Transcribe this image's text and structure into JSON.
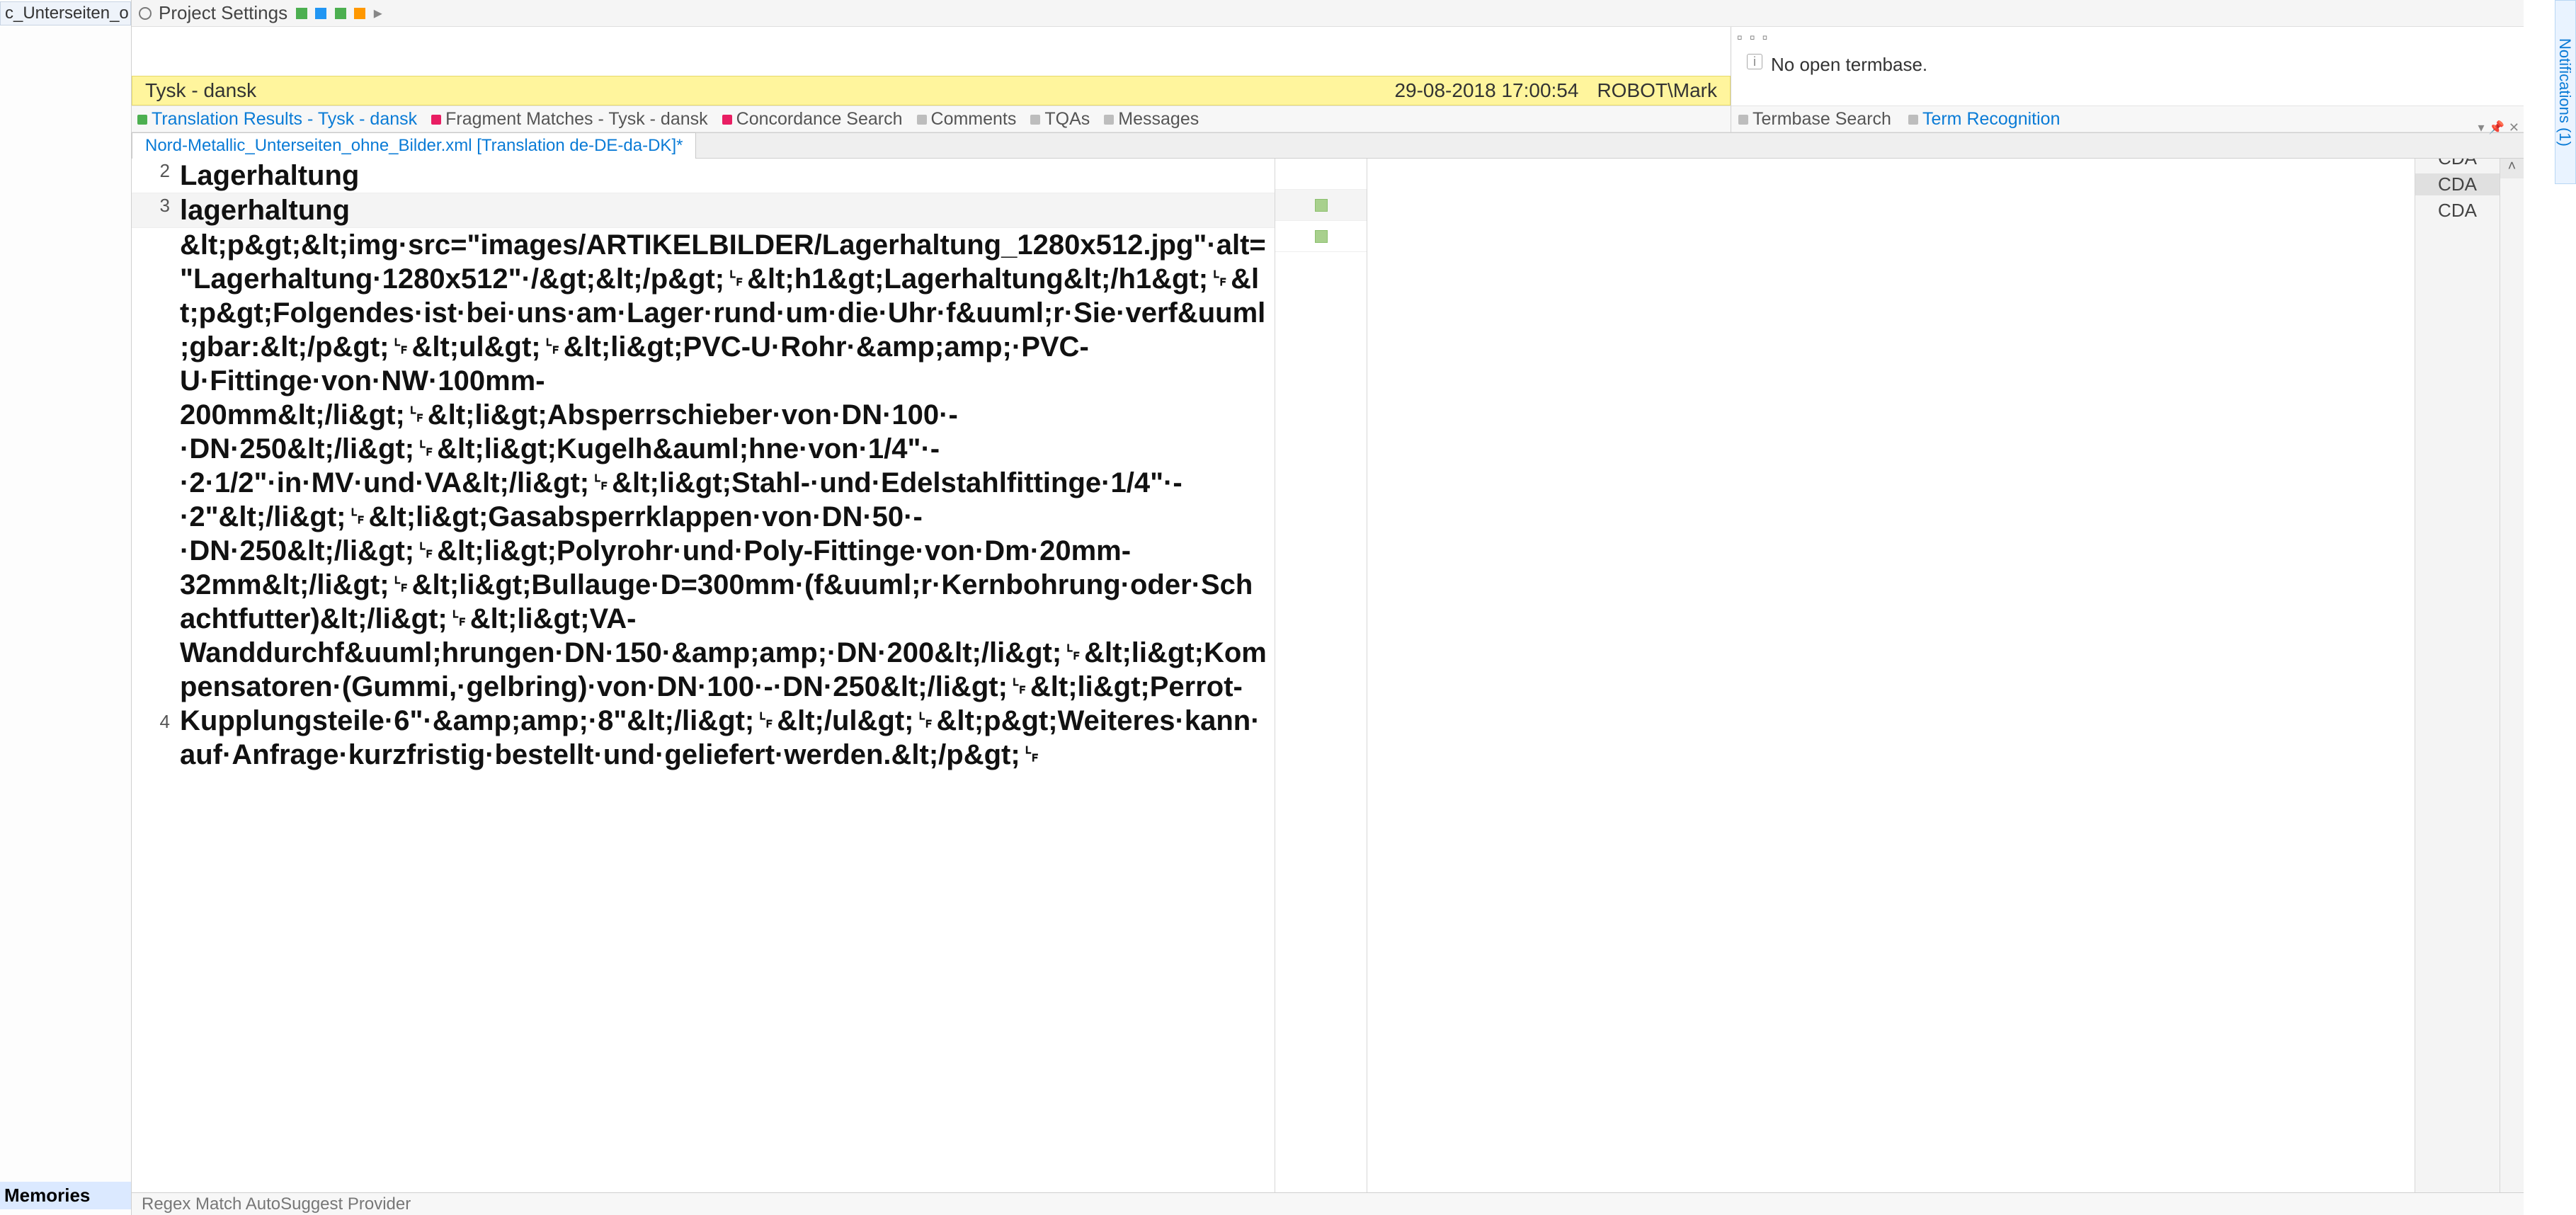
{
  "leftStrip": {
    "tabLabel": "c_Unterseiten_o",
    "bottom": "Memories"
  },
  "projectRow": {
    "title": "Project Settings"
  },
  "yellowBar": {
    "left": "Tysk - dansk",
    "date": "29-08-2018 17:00:54",
    "user": "ROBOT\\Mark"
  },
  "tmTabs": {
    "t1": "Translation Results - Tysk - dansk",
    "t2": "Fragment Matches - Tysk - dansk",
    "t3": "Concordance Search",
    "t4": "Comments",
    "t5": "TQAs",
    "t6": "Messages"
  },
  "termbase": {
    "msg": "No open termbase.",
    "tab1": "Termbase Search",
    "tab2": "Term Recognition"
  },
  "docTab": "Nord-Metallic_Unterseiten_ohne_Bilder.xml [Translation de-DE-da-DK]*",
  "rightCol": {
    "cda1": "CDA",
    "cda2": "CDA",
    "cda3": "CDA"
  },
  "segments": {
    "n2": "2",
    "s2": "Lagerhaltung",
    "n3": "3",
    "s3": "lagerhaltung",
    "n4": "4",
    "s4": "&lt;p&gt;&lt;img·src=\"images/ARTIKELBILDER/Lagerhaltung_1280x512.jpg\"·alt=\"Lagerhaltung·1280x512\"·/&gt;&lt;/p&gt;␊&lt;h1&gt;Lagerhaltung&lt;/h1&gt;␊&lt;p&gt;Folgendes·ist·bei·uns·am·Lager·rund·um·die·Uhr·f&uuml;r·Sie·verf&uuml;gbar:&lt;/p&gt;␊&lt;ul&gt;␊&lt;li&gt;PVC-U·Rohr·&amp;amp;·PVC-U·Fittinge·von·NW·100mm-200mm&lt;/li&gt;␊&lt;li&gt;Absperrschieber·von·DN·100·-·DN·250&lt;/li&gt;␊&lt;li&gt;Kugelh&auml;hne·von·1/4\"·-·2·1/2\"·in·MV·und·VA&lt;/li&gt;␊&lt;li&gt;Stahl-·und·Edelstahlfittinge·1/4\"·-·2\"&lt;/li&gt;␊&lt;li&gt;Gasabsperrklappen·von·DN·50·-·DN·250&lt;/li&gt;␊&lt;li&gt;Polyrohr·und·Poly-Fittinge·von·Dm·20mm-32mm&lt;/li&gt;␊&lt;li&gt;Bullauge·D=300mm·(f&uuml;r·Kernbohrung·oder·Schachtfutter)&lt;/li&gt;␊&lt;li&gt;VA-Wanddurchf&uuml;hrungen·DN·150·&amp;amp;·DN·200&lt;/li&gt;␊&lt;li&gt;Kompensatoren·(Gummi,·gelbring)·von·DN·100·-·DN·250&lt;/li&gt;␊&lt;li&gt;Perrot-Kupplungsteile·6\"·&amp;amp;·8\"&lt;/li&gt;␊&lt;/ul&gt;␊&lt;p&gt;Weiteres·kann·auf·Anfrage·kurzfristig·bestellt·und·geliefert·werden.&lt;/p&gt;␊"
  },
  "footer": "Regex Match AutoSuggest Provider",
  "notifications": "Notifications (1)"
}
